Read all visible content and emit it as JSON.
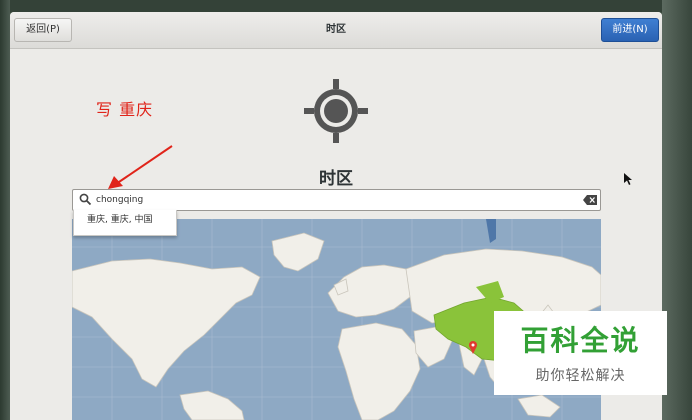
{
  "header": {
    "back_label": "返回(P)",
    "title": "时区",
    "next_label": "前进(N)"
  },
  "page_title": "时区",
  "annotation": {
    "text": "写  重庆"
  },
  "search": {
    "value": "chongqing"
  },
  "suggestion": {
    "text": "重庆, 重庆, 中国"
  },
  "watermark": {
    "main": "百科全说",
    "sub": "助你轻松解决"
  },
  "colors": {
    "accent": "#2a62b3",
    "annotation_red": "#e0241a",
    "selected_region": "#8ac33a",
    "ocean": "#8ea9c4",
    "land": "#f1efe9",
    "watermark_green": "#32a035"
  },
  "icons": [
    "timezone-icon",
    "search-icon",
    "clear-icon",
    "location-pin-icon",
    "cursor-icon"
  ]
}
